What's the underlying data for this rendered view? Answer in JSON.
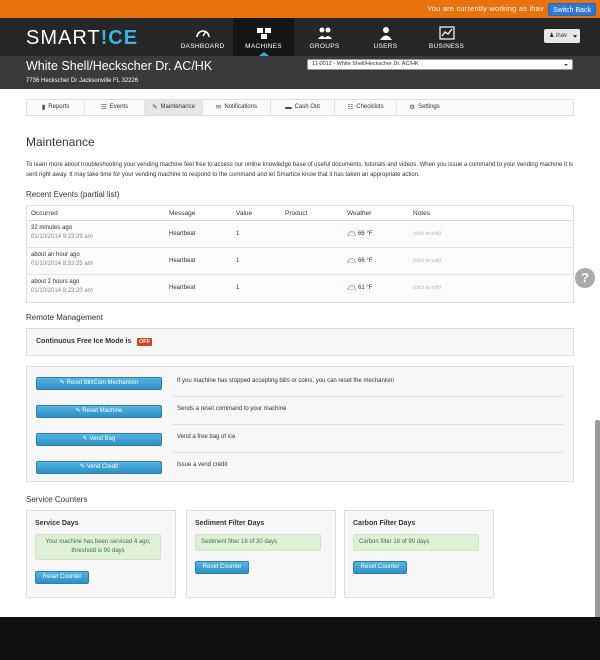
{
  "topbar": {
    "working_text": "You are currently working as ihav",
    "switch_back": "Switch Back"
  },
  "brand": {
    "logo_text": "SMART",
    "logo_ice": "!CE"
  },
  "nav": {
    "items": [
      {
        "label": "DASHBOARD",
        "icon": "gauge-icon",
        "active": false
      },
      {
        "label": "MACHINES",
        "icon": "machines-icon",
        "active": true
      },
      {
        "label": "GROUPS",
        "icon": "groups-icon",
        "active": false
      },
      {
        "label": "USERS",
        "icon": "user-icon",
        "active": false
      },
      {
        "label": "BUSINESS",
        "icon": "business-chart-icon",
        "active": false
      }
    ],
    "user": "ihav"
  },
  "machine": {
    "title": "White Shell/Heckscher Dr. AC/HK",
    "address": "7736 Heckscher Dr Jacksonville FL 32226",
    "selected": "11-0012 - White Shell/Heckscher Dr. AC/HK"
  },
  "tabs": [
    {
      "label": "Reports",
      "icon": "bar-chart-icon"
    },
    {
      "label": "Events",
      "icon": "list-icon"
    },
    {
      "label": "Maintenance",
      "icon": "wrench-icon"
    },
    {
      "label": "Notifications",
      "icon": "envelope-icon"
    },
    {
      "label": "Cash Out",
      "icon": "money-icon"
    },
    {
      "label": "Checklists",
      "icon": "checklist-icon"
    },
    {
      "label": "Settings",
      "icon": "gear-icon"
    }
  ],
  "page": {
    "title": "Maintenance",
    "intro": "To learn more about troubleshooting your vending machine feel free to access our online knowledge base of useful documents, tutorials and videos. When you issue a command to your vending machine it is sent right away. It may take time for your vending machine to respond to the command and let Smartice know that it has taken an appropriate action."
  },
  "events": {
    "heading": "Recent Events (partial list)",
    "columns": [
      "Occurred",
      "Message",
      "Value",
      "Product",
      "Weather",
      "Notes"
    ],
    "rows": [
      {
        "ago": "32 minutes ago",
        "ts": "01/10/2014 9:23:29 am",
        "message": "Heartbeat",
        "value": "1",
        "product": "",
        "weather": "66 °F",
        "note": "(click to edit)"
      },
      {
        "ago": "about an hour ago",
        "ts": "01/10/2014 8:53:25 am",
        "message": "Heartbeat",
        "value": "1",
        "product": "",
        "weather": "66 °F",
        "note": "(click to edit)"
      },
      {
        "ago": "about 2 hours ago",
        "ts": "01/10/2014 8:23:20 am",
        "message": "Heartbeat",
        "value": "1",
        "product": "",
        "weather": "61 °F",
        "note": "(click to edit)"
      }
    ]
  },
  "remote": {
    "heading": "Remote Management",
    "free_ice_label": "Continuous Free Ice Mode is",
    "free_ice_state": "OFF",
    "commands": [
      {
        "label": "Reset Bill/Coin Mechanism",
        "desc": "If you machine has stopped accepting bills or coins, you can reset the mechanism"
      },
      {
        "label": "Reset Machine",
        "desc": "Sends a reset command to your machine"
      },
      {
        "label": "Vend Bag",
        "desc": "Vend a free bag of ice"
      },
      {
        "label": "Vend Credit",
        "desc": "Issue a vend credit"
      }
    ]
  },
  "counters": {
    "heading": "Service Counters",
    "reset_label": "Reset Counter",
    "items": [
      {
        "title": "Service Days",
        "message": "Your machine has been serviced 4 ago, threshold is 90 days"
      },
      {
        "title": "Sediment Filter Days",
        "message": "Sediment filter 18 of 30 days"
      },
      {
        "title": "Carbon Filter Days",
        "message": "Carbon filter 18 of 90 days"
      }
    ]
  },
  "colors": {
    "accent": "#37b6e4",
    "topbar": "#e8730c",
    "nav": "#262626",
    "off_badge": "#d0461a",
    "success_bg": "#dff0d8"
  }
}
